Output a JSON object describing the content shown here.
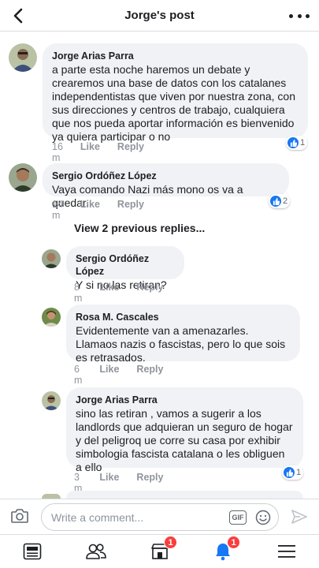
{
  "header": {
    "title": "Jorge's post",
    "back_icon": "chevron-left-icon",
    "more_icon": "more-dots-icon"
  },
  "comments": [
    {
      "author": "Jorge Arias Parra",
      "text": "a parte esta noche haremos un debate y crearemos una base de datos con los catalanes independentistas que viven por nuestra zona, con sus direcciones y centros de trabajo, cualquiera que nos pueda aportar información es bienvenido ya quiera participar o no",
      "time": "16 m",
      "like_label": "Like",
      "reply_label": "Reply",
      "reactions": "1"
    },
    {
      "author": "Sergio Ordóñez López",
      "text": "Vaya comando Nazi más mono os va a quedar.",
      "time": "14 m",
      "like_label": "Like",
      "reply_label": "Reply",
      "reactions": "2"
    }
  ],
  "view_previous_replies": "View 2 previous replies...",
  "replies": [
    {
      "author": "Sergio Ordóñez López",
      "text": "Y si no las retiran?",
      "time": "8 m",
      "like_label": "Like",
      "reply_label": "Reply"
    },
    {
      "author": "Rosa M. Cascales",
      "text": "Evidentemente van a amenazarles. Llamaos nazis o fascistas, pero lo que sois es retrasados.",
      "time": "6 m",
      "like_label": "Like",
      "reply_label": "Reply"
    },
    {
      "author": "Jorge Arias Parra",
      "text": "sino las retiran , vamos a sugerir a los landlords que adquieran un seguro de hogar y del peligroq ue corre su casa por exhibir simbologia fascista catalana o les obliguen a ello",
      "time": "3 m",
      "like_label": "Like",
      "reply_label": "Reply",
      "reactions": "1"
    }
  ],
  "composer": {
    "placeholder": "Write a comment...",
    "gif_label": "GIF"
  },
  "tabbar": {
    "marketplace_badge": "1",
    "notifications_badge": "1"
  },
  "colors": {
    "accent": "#1877f2",
    "badge": "#fa3e3e",
    "bubble": "#f0f2f5",
    "meta": "#90949c"
  }
}
